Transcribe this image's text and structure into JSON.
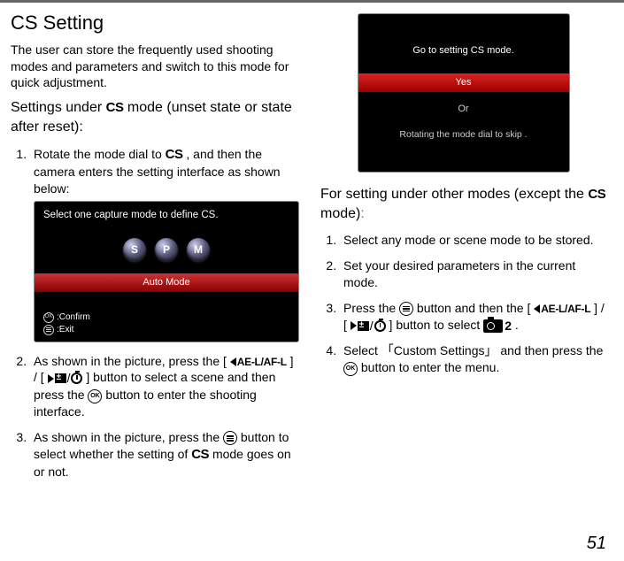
{
  "left": {
    "h1": "CS Setting",
    "intro": "The user can store the frequently used shooting modes and parameters and switch to this mode for quick adjustment.",
    "subhead_a": "Settings under ",
    "cs": "CS",
    "subhead_b": " mode (unset state or state after reset):",
    "step1_a": "Rotate the mode dial to ",
    "step1_b": " , and then the camera enters the setting interface as shown below:",
    "shot1_title": "Select one capture mode to define CS.",
    "shot1_modes": [
      "S",
      "P",
      "M"
    ],
    "shot1_selbar": "Auto Mode",
    "shot1_ok": "OK",
    "shot1_confirm": ":Confirm",
    "shot1_exit": ":Exit",
    "step2_a": "As shown in the picture, press the [ ",
    "aeafl": "AE-L/AF-L",
    "step2_b": " ] / [ ",
    "step2_c": " ] button to select a scene and then press the ",
    "step2_d": " button to enter the shooting interface.",
    "step3_a": "As shown in the picture, press the ",
    "step3_b": " button to select whether the setting of ",
    "step3_c": " mode goes on or not."
  },
  "right": {
    "shot2_line1": "Go to setting CS mode.",
    "shot2_yes": "Yes",
    "shot2_or": "Or",
    "shot2_rot": "Rotating the mode dial to skip .",
    "subhead_a": "For setting under other modes (except the ",
    "subhead_b": " mode)",
    "colon": ":",
    "step1": "Select any mode or scene mode to be stored.",
    "step2": "Set your desired parameters in the current mode.",
    "step3_a": "Press the ",
    "step3_b": " button and then the [ ",
    "step3_c": " ] / [ ",
    "step3_d": " ] button to select ",
    "step3_e": " .",
    "cam2_num": "2",
    "step4_a": "Select 「Custom Settings」 and then press the ",
    "step4_b": " button to enter the menu."
  },
  "ok_label": "OK",
  "pagenum": "51"
}
